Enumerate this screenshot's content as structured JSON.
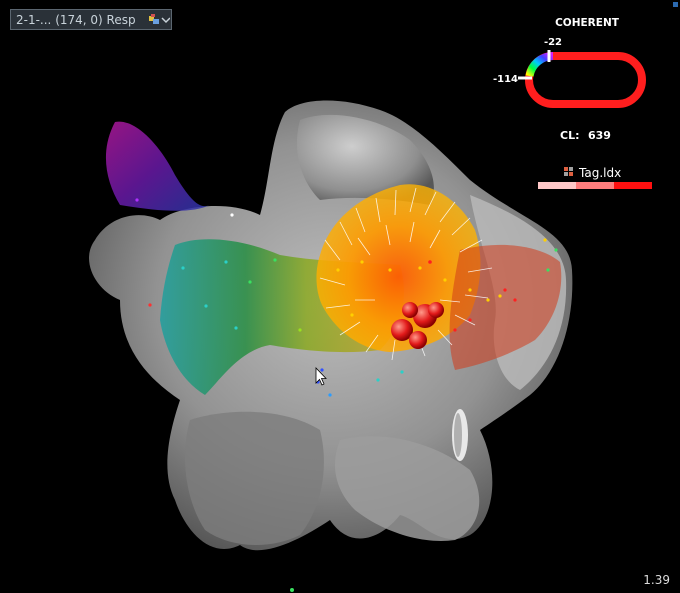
{
  "map_selector": {
    "value": "2-1-... (174, 0) Resp",
    "icon": "map-settings-icon"
  },
  "coherent_legend": {
    "title": "COHERENT",
    "high_value": "-22",
    "low_value": "-114",
    "cl_label": "CL:",
    "cl_value": "639"
  },
  "tag_legend": {
    "label": "Tag.ldx",
    "icon": "tag-grid-icon"
  },
  "zoom_level": "1.39",
  "colors": {
    "panel_bg": "#2a3138",
    "track_red": "#ff1e1e",
    "tag_bar": [
      "#ffc8c8",
      "#ff7d7d",
      "#ff1010"
    ]
  }
}
